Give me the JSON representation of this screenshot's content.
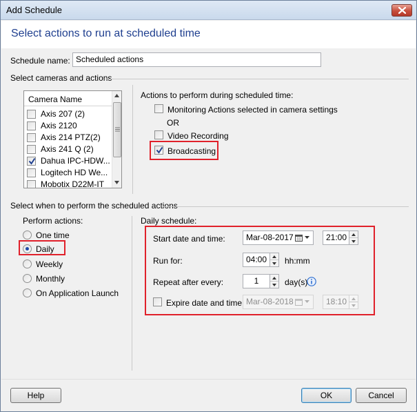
{
  "window": {
    "title": "Add Schedule"
  },
  "header": {
    "title": "Select actions to run at scheduled time"
  },
  "schedule_name": {
    "label": "Schedule name:",
    "value": "Scheduled actions"
  },
  "cameras_section": {
    "title": "Select cameras and actions"
  },
  "camera_list": {
    "header": "Camera Name",
    "items": [
      {
        "label": "Axis 207 (2)",
        "checked": false
      },
      {
        "label": "Axis 2120",
        "checked": false
      },
      {
        "label": "Axis 214 PTZ(2)",
        "checked": false
      },
      {
        "label": "Axis 241 Q (2)",
        "checked": false
      },
      {
        "label": "Dahua IPC-HDW...",
        "checked": true
      },
      {
        "label": "Logitech HD We...",
        "checked": false
      },
      {
        "label": "Mobotix D22M-IT",
        "checked": false
      }
    ]
  },
  "actions": {
    "title": "Actions to perform during scheduled time:",
    "monitoring_label": "Monitoring Actions selected in camera settings",
    "or_text": "OR",
    "video_label": "Video Recording",
    "broadcasting_label": "Broadcasting"
  },
  "when_section": {
    "title": "Select when to perform the scheduled actions"
  },
  "perform": {
    "title": "Perform actions:",
    "options": [
      "One time",
      "Daily",
      "Weekly",
      "Monthly",
      "On Application Launch"
    ],
    "selected": "Daily"
  },
  "daily": {
    "title": "Daily schedule:",
    "start_label": "Start date and time:",
    "start_date": "Mar-08-2017",
    "start_time": "21:00",
    "run_label": "Run for:",
    "run_value": "04:00",
    "run_unit": "hh:mm",
    "repeat_label": "Repeat after every:",
    "repeat_value": "1",
    "repeat_unit": "day(s)",
    "expire_label": "Expire date and time:",
    "expire_date": "Mar-08-2018",
    "expire_time": "18:10"
  },
  "footer": {
    "help_label": "Help",
    "ok_label": "OK",
    "cancel_label": "Cancel"
  },
  "colors": {
    "title_blue": "#1f3f8f",
    "highlight_red": "#e0202a",
    "info_blue": "#2f6fd0"
  }
}
